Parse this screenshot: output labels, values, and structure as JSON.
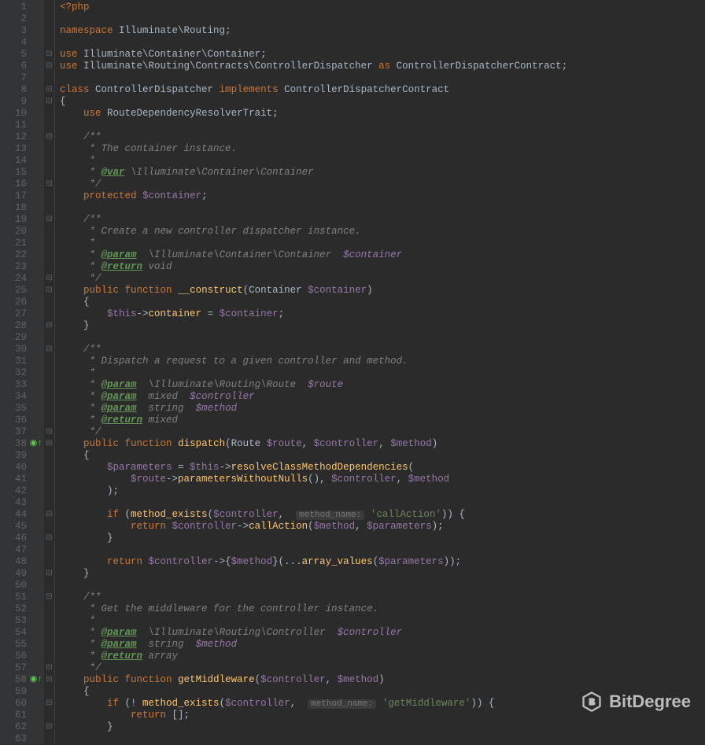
{
  "watermark": "BitDegree",
  "hint": "method_name:",
  "lines": [
    {
      "n": 1,
      "f": "",
      "s": [
        [
          "php",
          "<?php"
        ]
      ]
    },
    {
      "n": 2,
      "f": "",
      "s": []
    },
    {
      "n": 3,
      "f": "",
      "s": [
        [
          "kw",
          "namespace"
        ],
        [
          "p",
          " "
        ],
        [
          "cls",
          "Illuminate\\Routing"
        ],
        [
          "p",
          ";"
        ]
      ]
    },
    {
      "n": 4,
      "f": "",
      "s": []
    },
    {
      "n": 5,
      "f": "⊟",
      "s": [
        [
          "kw",
          "use"
        ],
        [
          "p",
          " "
        ],
        [
          "cls",
          "Illuminate\\Container\\Container"
        ],
        [
          "p",
          ";"
        ]
      ]
    },
    {
      "n": 6,
      "f": "⊟",
      "s": [
        [
          "kw",
          "use"
        ],
        [
          "p",
          " "
        ],
        [
          "cls",
          "Illuminate\\Routing\\Contracts\\ControllerDispatcher"
        ],
        [
          "p",
          " "
        ],
        [
          "kw",
          "as"
        ],
        [
          "p",
          " "
        ],
        [
          "cls",
          "ControllerDispatcherContract"
        ],
        [
          "p",
          ";"
        ]
      ]
    },
    {
      "n": 7,
      "f": "",
      "s": []
    },
    {
      "n": 8,
      "f": "⊟",
      "s": [
        [
          "kw",
          "class"
        ],
        [
          "p",
          " "
        ],
        [
          "cls",
          "ControllerDispatcher"
        ],
        [
          "p",
          " "
        ],
        [
          "kw",
          "implements"
        ],
        [
          "p",
          " "
        ],
        [
          "cls",
          "ControllerDispatcherContract"
        ]
      ]
    },
    {
      "n": 9,
      "f": "⊟",
      "s": [
        [
          "p",
          "{"
        ]
      ]
    },
    {
      "n": 10,
      "f": "",
      "s": [
        [
          "p",
          "    "
        ],
        [
          "kw",
          "use"
        ],
        [
          "p",
          " "
        ],
        [
          "cls",
          "RouteDependencyResolverTrait"
        ],
        [
          "p",
          ";"
        ]
      ]
    },
    {
      "n": 11,
      "f": "",
      "s": []
    },
    {
      "n": 12,
      "f": "⊟",
      "it": true,
      "s": [
        [
          "p",
          "    "
        ],
        [
          "cm",
          "/**"
        ]
      ]
    },
    {
      "n": 13,
      "f": "",
      "it": true,
      "s": [
        [
          "p",
          "    "
        ],
        [
          "cm",
          " * The container instance."
        ]
      ]
    },
    {
      "n": 14,
      "f": "",
      "it": true,
      "s": [
        [
          "p",
          "    "
        ],
        [
          "cm",
          " *"
        ]
      ]
    },
    {
      "n": 15,
      "f": "",
      "it": true,
      "s": [
        [
          "p",
          "    "
        ],
        [
          "cm",
          " * "
        ],
        [
          "tag",
          "@var"
        ],
        [
          "cm",
          " \\Illuminate\\Container\\Container"
        ]
      ]
    },
    {
      "n": 16,
      "f": "⊟",
      "it": true,
      "s": [
        [
          "p",
          "    "
        ],
        [
          "cm",
          " */"
        ]
      ]
    },
    {
      "n": 17,
      "f": "",
      "s": [
        [
          "p",
          "    "
        ],
        [
          "kw",
          "protected"
        ],
        [
          "p",
          " "
        ],
        [
          "var",
          "$container"
        ],
        [
          "p",
          ";"
        ]
      ]
    },
    {
      "n": 18,
      "f": "",
      "s": []
    },
    {
      "n": 19,
      "f": "⊟",
      "it": true,
      "s": [
        [
          "p",
          "    "
        ],
        [
          "cm",
          "/**"
        ]
      ]
    },
    {
      "n": 20,
      "f": "",
      "it": true,
      "s": [
        [
          "p",
          "    "
        ],
        [
          "cm",
          " * Create a new controller dispatcher instance."
        ]
      ]
    },
    {
      "n": 21,
      "f": "",
      "it": true,
      "s": [
        [
          "p",
          "    "
        ],
        [
          "cm",
          " *"
        ]
      ]
    },
    {
      "n": 22,
      "f": "",
      "it": true,
      "s": [
        [
          "p",
          "    "
        ],
        [
          "cm",
          " * "
        ],
        [
          "tag",
          "@param"
        ],
        [
          "cm",
          "  \\Illuminate\\Container\\Container  "
        ],
        [
          "vari",
          "$container"
        ]
      ]
    },
    {
      "n": 23,
      "f": "",
      "it": true,
      "s": [
        [
          "p",
          "    "
        ],
        [
          "cm",
          " * "
        ],
        [
          "tag",
          "@return"
        ],
        [
          "cm",
          " void"
        ]
      ]
    },
    {
      "n": 24,
      "f": "⊟",
      "it": true,
      "s": [
        [
          "p",
          "    "
        ],
        [
          "cm",
          " */"
        ]
      ]
    },
    {
      "n": 25,
      "f": "⊟",
      "s": [
        [
          "p",
          "    "
        ],
        [
          "kw",
          "public"
        ],
        [
          "p",
          " "
        ],
        [
          "kw",
          "function"
        ],
        [
          "p",
          " "
        ],
        [
          "fn",
          "__construct"
        ],
        [
          "p",
          "("
        ],
        [
          "cls",
          "Container"
        ],
        [
          "p",
          " "
        ],
        [
          "var",
          "$container"
        ],
        [
          "p",
          ")"
        ]
      ]
    },
    {
      "n": 26,
      "f": "",
      "s": [
        [
          "p",
          "    {"
        ]
      ]
    },
    {
      "n": 27,
      "f": "",
      "s": [
        [
          "p",
          "        "
        ],
        [
          "var",
          "$this"
        ],
        [
          "op",
          "->"
        ],
        [
          "fn",
          "container"
        ],
        [
          "p",
          " = "
        ],
        [
          "var",
          "$container"
        ],
        [
          "p",
          ";"
        ]
      ]
    },
    {
      "n": 28,
      "f": "⊟",
      "s": [
        [
          "p",
          "    }"
        ]
      ]
    },
    {
      "n": 29,
      "f": "",
      "s": []
    },
    {
      "n": 30,
      "f": "⊟",
      "it": true,
      "s": [
        [
          "p",
          "    "
        ],
        [
          "cm",
          "/**"
        ]
      ]
    },
    {
      "n": 31,
      "f": "",
      "it": true,
      "s": [
        [
          "p",
          "    "
        ],
        [
          "cm",
          " * Dispatch a request to a given controller and method."
        ]
      ]
    },
    {
      "n": 32,
      "f": "",
      "it": true,
      "s": [
        [
          "p",
          "    "
        ],
        [
          "cm",
          " *"
        ]
      ]
    },
    {
      "n": 33,
      "f": "",
      "it": true,
      "s": [
        [
          "p",
          "    "
        ],
        [
          "cm",
          " * "
        ],
        [
          "tag",
          "@param"
        ],
        [
          "cm",
          "  \\Illuminate\\Routing\\Route  "
        ],
        [
          "vari",
          "$route"
        ]
      ]
    },
    {
      "n": 34,
      "f": "",
      "it": true,
      "s": [
        [
          "p",
          "    "
        ],
        [
          "cm",
          " * "
        ],
        [
          "tag",
          "@param"
        ],
        [
          "cm",
          "  mixed  "
        ],
        [
          "vari",
          "$controller"
        ]
      ]
    },
    {
      "n": 35,
      "f": "",
      "it": true,
      "s": [
        [
          "p",
          "    "
        ],
        [
          "cm",
          " * "
        ],
        [
          "tag",
          "@param"
        ],
        [
          "cm",
          "  string  "
        ],
        [
          "vari",
          "$method"
        ]
      ]
    },
    {
      "n": 36,
      "f": "",
      "it": true,
      "s": [
        [
          "p",
          "    "
        ],
        [
          "cm",
          " * "
        ],
        [
          "tag",
          "@return"
        ],
        [
          "cm",
          " mixed"
        ]
      ]
    },
    {
      "n": 37,
      "f": "⊟",
      "it": true,
      "s": [
        [
          "p",
          "    "
        ],
        [
          "cm",
          " */"
        ]
      ]
    },
    {
      "n": 38,
      "f": "⊟",
      "mark": "green",
      "s": [
        [
          "p",
          "    "
        ],
        [
          "kw",
          "public"
        ],
        [
          "p",
          " "
        ],
        [
          "kw",
          "function"
        ],
        [
          "p",
          " "
        ],
        [
          "fn",
          "dispatch"
        ],
        [
          "p",
          "("
        ],
        [
          "cls",
          "Route"
        ],
        [
          "p",
          " "
        ],
        [
          "var",
          "$route"
        ],
        [
          "p",
          ", "
        ],
        [
          "var",
          "$controller"
        ],
        [
          "p",
          ", "
        ],
        [
          "var",
          "$method"
        ],
        [
          "p",
          ")"
        ]
      ]
    },
    {
      "n": 39,
      "f": "",
      "s": [
        [
          "p",
          "    {"
        ]
      ]
    },
    {
      "n": 40,
      "f": "",
      "s": [
        [
          "p",
          "        "
        ],
        [
          "var",
          "$parameters"
        ],
        [
          "p",
          " = "
        ],
        [
          "var",
          "$this"
        ],
        [
          "op",
          "->"
        ],
        [
          "fn",
          "resolveClassMethodDependencies"
        ],
        [
          "p",
          "("
        ]
      ]
    },
    {
      "n": 41,
      "f": "",
      "s": [
        [
          "p",
          "            "
        ],
        [
          "var",
          "$route"
        ],
        [
          "op",
          "->"
        ],
        [
          "fn",
          "parametersWithoutNulls"
        ],
        [
          "p",
          "(), "
        ],
        [
          "var",
          "$controller"
        ],
        [
          "p",
          ", "
        ],
        [
          "var",
          "$method"
        ]
      ]
    },
    {
      "n": 42,
      "f": "",
      "s": [
        [
          "p",
          "        );"
        ]
      ]
    },
    {
      "n": 43,
      "f": "",
      "s": []
    },
    {
      "n": 44,
      "f": "⊟",
      "s": [
        [
          "p",
          "        "
        ],
        [
          "kw",
          "if"
        ],
        [
          "p",
          " ("
        ],
        [
          "fn",
          "method_exists"
        ],
        [
          "p",
          "("
        ],
        [
          "var",
          "$controller"
        ],
        [
          "p",
          ",  "
        ],
        [
          "hint",
          "method_name:"
        ],
        [
          "p",
          " "
        ],
        [
          "str",
          "'callAction'"
        ],
        [
          "p",
          ")) {"
        ]
      ]
    },
    {
      "n": 45,
      "f": "",
      "s": [
        [
          "p",
          "            "
        ],
        [
          "kw",
          "return"
        ],
        [
          "p",
          " "
        ],
        [
          "var",
          "$controller"
        ],
        [
          "op",
          "->"
        ],
        [
          "fn",
          "callAction"
        ],
        [
          "p",
          "("
        ],
        [
          "var",
          "$method"
        ],
        [
          "p",
          ", "
        ],
        [
          "var",
          "$parameters"
        ],
        [
          "p",
          ");"
        ]
      ]
    },
    {
      "n": 46,
      "f": "⊟",
      "s": [
        [
          "p",
          "        }"
        ]
      ]
    },
    {
      "n": 47,
      "f": "",
      "s": []
    },
    {
      "n": 48,
      "f": "",
      "s": [
        [
          "p",
          "        "
        ],
        [
          "kw",
          "return"
        ],
        [
          "p",
          " "
        ],
        [
          "var",
          "$controller"
        ],
        [
          "op",
          "->"
        ],
        [
          "p",
          "{"
        ],
        [
          "var",
          "$method"
        ],
        [
          "p",
          "}(..."
        ],
        [
          "fn",
          "array_values"
        ],
        [
          "p",
          "("
        ],
        [
          "var",
          "$parameters"
        ],
        [
          "p",
          "));"
        ]
      ]
    },
    {
      "n": 49,
      "f": "⊟",
      "s": [
        [
          "p",
          "    }"
        ]
      ]
    },
    {
      "n": 50,
      "f": "",
      "s": []
    },
    {
      "n": 51,
      "f": "⊟",
      "it": true,
      "s": [
        [
          "p",
          "    "
        ],
        [
          "cm",
          "/**"
        ]
      ]
    },
    {
      "n": 52,
      "f": "",
      "it": true,
      "s": [
        [
          "p",
          "    "
        ],
        [
          "cm",
          " * Get the middleware for the controller instance."
        ]
      ]
    },
    {
      "n": 53,
      "f": "",
      "it": true,
      "s": [
        [
          "p",
          "    "
        ],
        [
          "cm",
          " *"
        ]
      ]
    },
    {
      "n": 54,
      "f": "",
      "it": true,
      "s": [
        [
          "p",
          "    "
        ],
        [
          "cm",
          " * "
        ],
        [
          "tag",
          "@param"
        ],
        [
          "cm",
          "  \\Illuminate\\Routing\\Controller  "
        ],
        [
          "vari",
          "$controller"
        ]
      ]
    },
    {
      "n": 55,
      "f": "",
      "it": true,
      "s": [
        [
          "p",
          "    "
        ],
        [
          "cm",
          " * "
        ],
        [
          "tag",
          "@param"
        ],
        [
          "cm",
          "  string  "
        ],
        [
          "vari",
          "$method"
        ]
      ]
    },
    {
      "n": 56,
      "f": "",
      "it": true,
      "s": [
        [
          "p",
          "    "
        ],
        [
          "cm",
          " * "
        ],
        [
          "tag",
          "@return"
        ],
        [
          "cm",
          " array"
        ]
      ]
    },
    {
      "n": 57,
      "f": "⊟",
      "it": true,
      "s": [
        [
          "p",
          "    "
        ],
        [
          "cm",
          " */"
        ]
      ]
    },
    {
      "n": 58,
      "f": "⊟",
      "mark": "green",
      "s": [
        [
          "p",
          "    "
        ],
        [
          "kw",
          "public"
        ],
        [
          "p",
          " "
        ],
        [
          "kw",
          "function"
        ],
        [
          "p",
          " "
        ],
        [
          "fn",
          "getMiddleware"
        ],
        [
          "p",
          "("
        ],
        [
          "var",
          "$controller"
        ],
        [
          "p",
          ", "
        ],
        [
          "var",
          "$method"
        ],
        [
          "p",
          ")"
        ]
      ]
    },
    {
      "n": 59,
      "f": "",
      "s": [
        [
          "p",
          "    {"
        ]
      ]
    },
    {
      "n": 60,
      "f": "⊟",
      "s": [
        [
          "p",
          "        "
        ],
        [
          "kw",
          "if"
        ],
        [
          "p",
          " (! "
        ],
        [
          "fn",
          "method_exists"
        ],
        [
          "p",
          "("
        ],
        [
          "var",
          "$controller"
        ],
        [
          "p",
          ",  "
        ],
        [
          "hint",
          "method_name:"
        ],
        [
          "p",
          " "
        ],
        [
          "str",
          "'getMiddleware'"
        ],
        [
          "p",
          ")) {"
        ]
      ]
    },
    {
      "n": 61,
      "f": "",
      "s": [
        [
          "p",
          "            "
        ],
        [
          "kw",
          "return"
        ],
        [
          "p",
          " [];"
        ]
      ]
    },
    {
      "n": 62,
      "f": "⊟",
      "s": [
        [
          "p",
          "        }"
        ]
      ]
    },
    {
      "n": 63,
      "f": "",
      "s": []
    }
  ]
}
